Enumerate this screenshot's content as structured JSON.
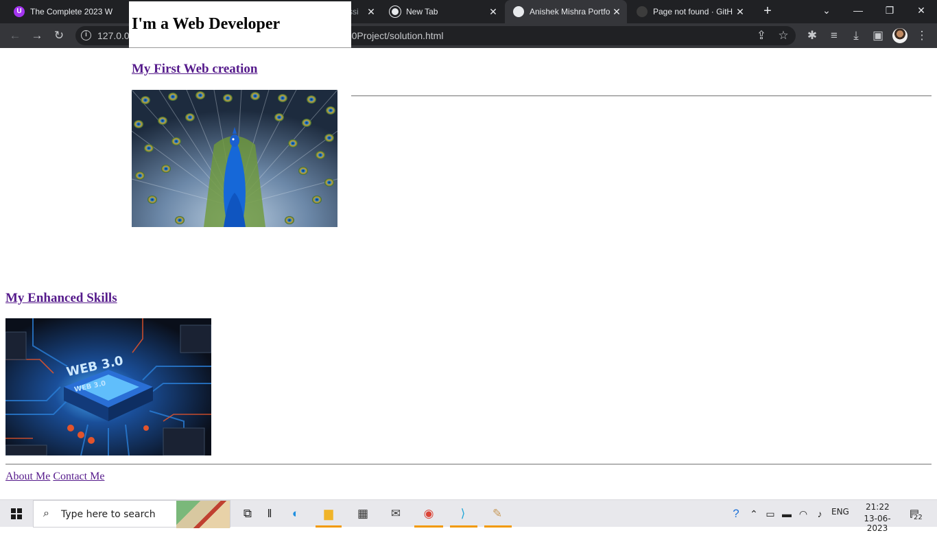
{
  "browser": {
    "tabs": [
      {
        "title": "The Complete 2023 W",
        "favicon_color": "#a435f0",
        "favicon_letter": "U"
      },
      {
        "title": "ssi",
        "favicon_color": "#5f6368",
        "favicon_letter": ""
      },
      {
        "title": "New Tab",
        "favicon_color": "#e8eaed",
        "favicon_letter": ""
      },
      {
        "title": "Anishek Mishra Portfo",
        "favicon_color": "#e8eaed",
        "favicon_letter": ""
      },
      {
        "title": "Page not found · GitH",
        "favicon_color": "#3c3c3c",
        "favicon_letter": ""
      }
    ],
    "new_tab_glyph": "+",
    "url_left": "127.0.0.",
    "url_right": "0Project/solution.html"
  },
  "page": {
    "heading": "I'm a Web Developer",
    "first_link": "My First Web creation",
    "second_link": "My Enhanced Skills",
    "image2_text_big": "WEB 3.0",
    "image2_text_small": "WEB 3.0",
    "footer_links": [
      "About Me",
      "Contact Me"
    ]
  },
  "taskbar": {
    "search_placeholder": "Type here to search",
    "language": "ENG",
    "time": "21:22",
    "date": "13-06-2023",
    "notifications": "22"
  },
  "colors": {
    "visited_link": "#551a8b",
    "tabbar_bg": "#202124",
    "toolbar_bg": "#35363a"
  }
}
